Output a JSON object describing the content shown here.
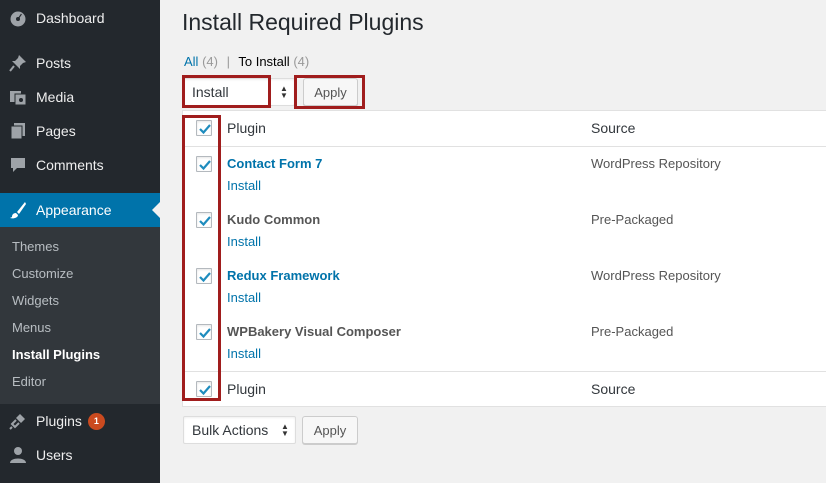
{
  "sidebar": {
    "items": [
      {
        "label": "Dashboard",
        "icon": "dashboard-icon"
      },
      {
        "label": "Posts",
        "icon": "pin-icon"
      },
      {
        "label": "Media",
        "icon": "media-icon"
      },
      {
        "label": "Pages",
        "icon": "pages-icon"
      },
      {
        "label": "Comments",
        "icon": "comment-icon"
      },
      {
        "label": "Appearance",
        "icon": "brush-icon"
      },
      {
        "label": "Plugins",
        "icon": "plug-icon",
        "badge": "1"
      },
      {
        "label": "Users",
        "icon": "user-icon"
      }
    ],
    "submenu": [
      "Themes",
      "Customize",
      "Widgets",
      "Menus",
      "Install Plugins",
      "Editor"
    ],
    "current_submenu": "Install Plugins"
  },
  "page": {
    "title": "Install Required Plugins",
    "filters": {
      "all_label": "All",
      "all_count": "(4)",
      "separator": "|",
      "to_install_label": "To Install",
      "to_install_count": "(4)"
    },
    "top_action": {
      "selected": "Install",
      "apply_label": "Apply"
    },
    "bottom_action": {
      "selected": "Bulk Actions",
      "apply_label": "Apply"
    }
  },
  "table": {
    "headers": {
      "plugin": "Plugin",
      "source": "Source"
    },
    "footers": {
      "plugin": "Plugin",
      "source": "Source"
    },
    "rows": [
      {
        "name": "Contact Form 7",
        "action": "Install",
        "source": "WordPress Repository",
        "linked": true
      },
      {
        "name": "Kudo Common",
        "action": "Install",
        "source": "Pre-Packaged",
        "linked": false
      },
      {
        "name": "Redux Framework",
        "action": "Install",
        "source": "WordPress Repository",
        "linked": true
      },
      {
        "name": "WPBakery Visual Composer",
        "action": "Install",
        "source": "Pre-Packaged",
        "linked": false
      }
    ]
  },
  "colors": {
    "sidebar_bg": "#23282d",
    "active_bg": "#0073aa",
    "link": "#0073aa",
    "highlight_border": "#a01d1d",
    "badge": "#ca4a1f"
  }
}
